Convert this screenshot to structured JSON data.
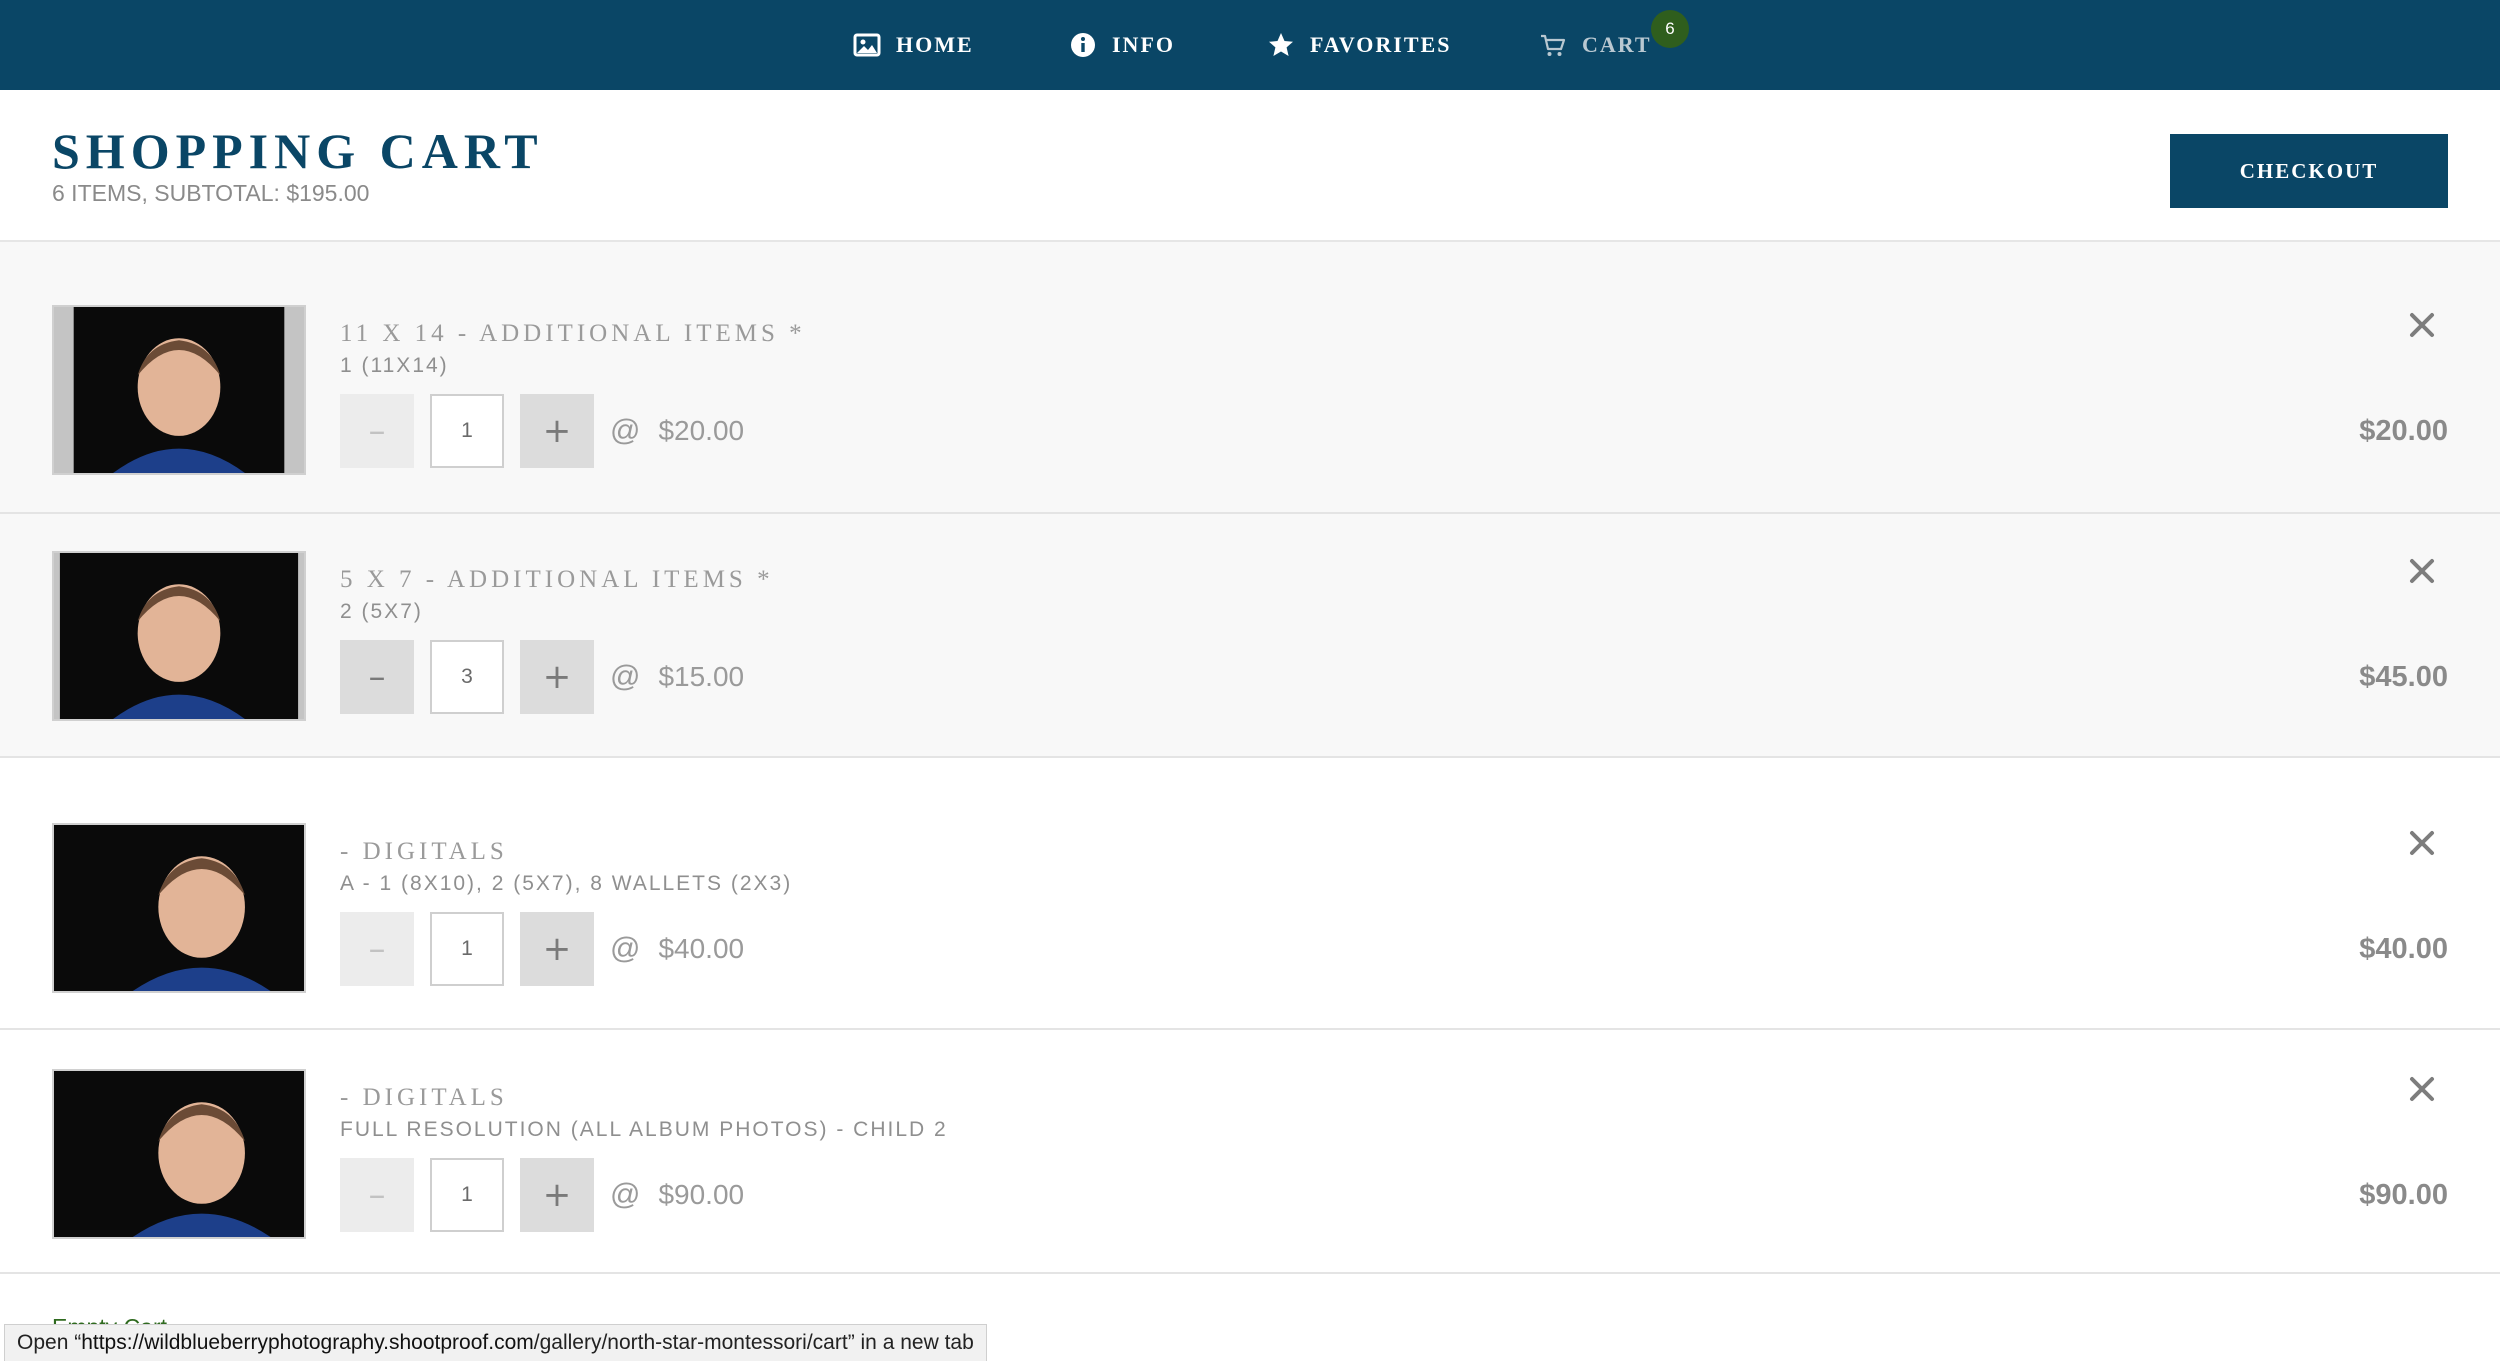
{
  "nav": {
    "home": "HOME",
    "info": "INFO",
    "favorites": "FAVORITES",
    "cart": "CART",
    "cart_count": "6"
  },
  "header": {
    "title": "SHOPPING CART",
    "summary": "6 ITEMS, SUBTOTAL: $195.00",
    "checkout": "CHECKOUT"
  },
  "items": [
    {
      "title": "11 X 14 - ADDITIONAL ITEMS *",
      "subtitle": "1 (11X14)",
      "qty": "1",
      "at": "@",
      "unit_price": "$20.00",
      "total": "$20.00"
    },
    {
      "title": "5 X 7 - ADDITIONAL ITEMS *",
      "subtitle": "2 (5X7)",
      "qty": "3",
      "at": "@",
      "unit_price": "$15.00",
      "total": "$45.00"
    },
    {
      "title": "- DIGITALS",
      "subtitle": "A - 1 (8X10), 2 (5X7), 8 WALLETS (2X3)",
      "qty": "1",
      "at": "@",
      "unit_price": "$40.00",
      "total": "$40.00"
    },
    {
      "title": "- DIGITALS",
      "subtitle": "FULL RESOLUTION (ALL ALBUM PHOTOS) - CHILD 2",
      "qty": "1",
      "at": "@",
      "unit_price": "$90.00",
      "total": "$90.00"
    }
  ],
  "controls": {
    "minus": "–",
    "plus": "+"
  },
  "footer": {
    "empty_cart": "Empty Cart",
    "status_prefix": "Open “",
    "status_host": "https://wildblueberryphotography.shootproof.com",
    "status_path": "/gallery/north-star-montessori/cart",
    "status_suffix": "” in a new tab"
  },
  "colors": {
    "nav_bg": "#0a4666",
    "accent": "#0a4666",
    "badge": "#2f5e1d"
  }
}
